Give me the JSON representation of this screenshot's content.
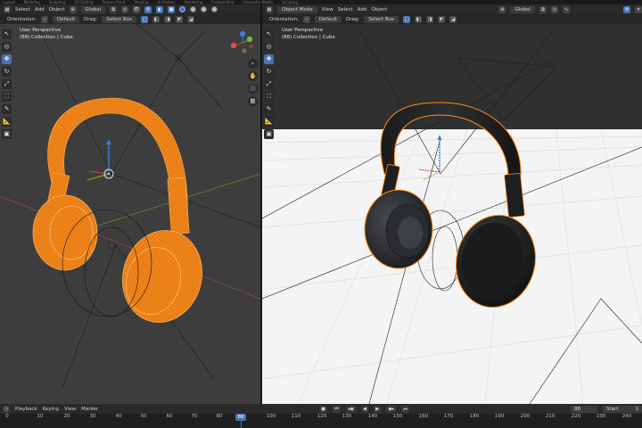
{
  "workspace_tabs": [
    "Layout",
    "Modeling",
    "Sculpting",
    "UV Editing",
    "Texture Paint",
    "Shading",
    "Animation",
    "Rendering",
    "Compositing",
    "Geometry Nodes",
    "Scripting"
  ],
  "left_viewport": {
    "menu": [
      "Select",
      "Add",
      "Object"
    ],
    "transform_orientation": "Global",
    "orientation_label": "Orientation:",
    "orientation_value": "Default",
    "drag_label": "Drag:",
    "drag_value": "Select Box",
    "view_name": "User Perspective",
    "collection_line": "(88) Collection | Cube"
  },
  "right_viewport": {
    "mode": "Object Mode",
    "menu": [
      "View",
      "Select",
      "Add",
      "Object"
    ],
    "transform_orientation": "Global",
    "orientation_label": "Orientation:",
    "orientation_value": "Default",
    "drag_label": "Drag:",
    "drag_value": "Select Box",
    "view_name": "User Perspective",
    "collection_line": "(88) Collection | Cube"
  },
  "timeline": {
    "menu": [
      "Playback",
      "Keying",
      "View",
      "Marker"
    ],
    "current_frame": "88",
    "start_label": "Start",
    "start_value": "1",
    "ruler_ticks": [
      "0",
      "10",
      "20",
      "30",
      "40",
      "50",
      "60",
      "70",
      "80",
      "90",
      "100",
      "110",
      "120",
      "130",
      "140",
      "150",
      "160",
      "170",
      "180",
      "190",
      "200",
      "210",
      "220",
      "230",
      "240"
    ]
  },
  "colors": {
    "selection_orange": "#ff8c1a",
    "active_blue": "#4772b3",
    "viewport_grey": "#3d3d3d",
    "render_white": "#f4f4f4"
  }
}
